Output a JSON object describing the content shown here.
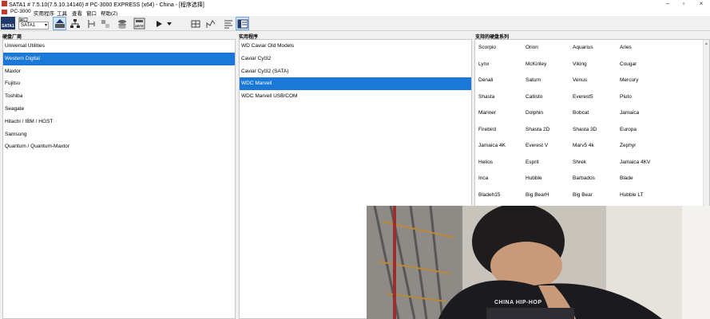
{
  "window": {
    "title": "SATA1 # 7.5.10(7.5.10.14140) # PC-3000 EXPRESS (x64) - China - [程序选择]",
    "menu": [
      "PC-3000",
      "实用程序",
      "工具",
      "查看",
      "窗口",
      "帮助(Z)"
    ]
  },
  "toolbar": {
    "port_label": "端口",
    "port_value": "SATA1",
    "sata_badge": "SATA1",
    "icons": [
      "sata-port-icon",
      "drive-map-icon",
      "network-icon",
      "tool-a-icon",
      "tool-b-icon",
      "tool-c-icon",
      "disk-stack-icon",
      "arte-icon",
      "play-icon",
      "dropdown-icon",
      "grid-icon",
      "chart-icon",
      "list-icon",
      "panel-icon"
    ]
  },
  "vendors": {
    "header": "硬盘厂商",
    "items": [
      "Universal Utilities",
      "Western Digital",
      "Maxtor",
      "Fujitsu",
      "Toshiba",
      "Seagate",
      "Hitachi / IBM / HGST",
      "Samsung",
      "Quantum / Quantum-Maxtor"
    ],
    "selected_index": 1
  },
  "utilities": {
    "header": "实用程序",
    "items": [
      "WD Caviar Old Models",
      "Caviar Cyl32",
      "Caviar Cyl32 (SATA)",
      "WDC Marvell",
      "WDC Marvell USB/COM"
    ],
    "selected_index": 3
  },
  "families": {
    "header": "支持的硬盘系列",
    "rows": [
      [
        "Scorpio",
        "Orion",
        "Aquarius",
        "Aries"
      ],
      [
        "Lynx",
        "McKinley",
        "Viking",
        "Cougar"
      ],
      [
        "Denali",
        "Saturn",
        "Venus",
        "Mercury"
      ],
      [
        "Shasta",
        "Callisto",
        "Everest5",
        "Pluto"
      ],
      [
        "Mariner",
        "Dolphin",
        "Bobcat",
        "Jamaica"
      ],
      [
        "Firebird",
        "Shasta 2D",
        "Shasta 3D",
        "Europa"
      ],
      [
        "Jamaica 4K",
        "Everest V",
        "Marv5 4k",
        "Zephyr"
      ],
      [
        "Helios",
        "Esprit",
        "Shrek",
        "Jamaica 4KV"
      ],
      [
        "Inca",
        "Hubble",
        "Barbados",
        "Blade"
      ],
      [
        "Bladeh15",
        "Big BearH",
        "Big Bear",
        "Hubble LT"
      ],
      [
        "",
        "",
        "",
        ""
      ]
    ]
  },
  "webcam": {
    "shirt_text": "CHINA HIP-HOP"
  },
  "colors": {
    "selection": "#1a78d6",
    "app_accent": "#c0392b"
  }
}
